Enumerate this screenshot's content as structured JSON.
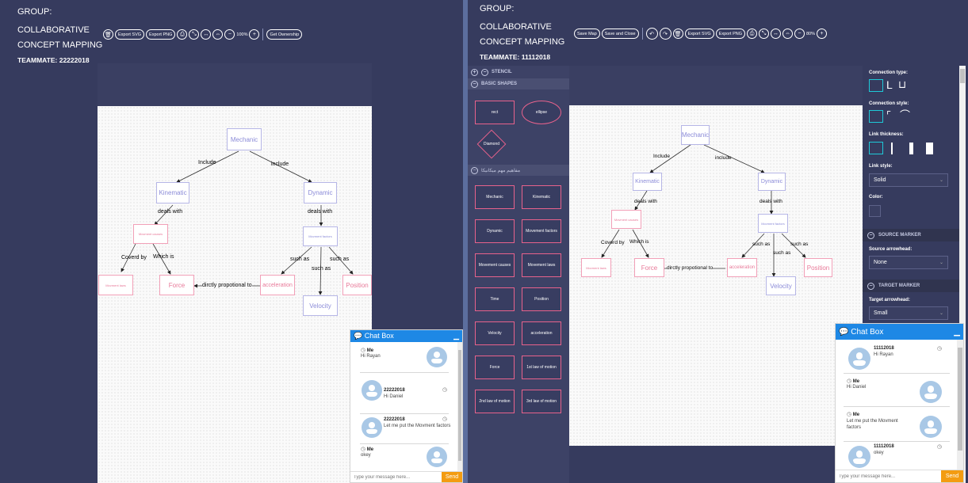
{
  "left": {
    "group": "GROUP:",
    "line1": "COLLABORATIVE",
    "line2": "CONCEPT MAPPING",
    "teammate": "TEAMMATE: 22222018",
    "toolbar": {
      "export_svg": "Export SVG",
      "export_png": "Export PNG",
      "zoom": "100%",
      "get_ownership": "Get Ownership"
    },
    "map": {
      "nodes": {
        "mechanic": "Mechanic",
        "kinematic": "Kinematic",
        "dynamic": "Dynamic",
        "movement_causes": "Movment causes",
        "movement_factors": "Movment factors",
        "movement_laws": "Movment laws",
        "force": "Force",
        "acceleration": "acceleration",
        "position": "Position",
        "velocity": "Velocity"
      },
      "links": {
        "include_left": "Include",
        "include_right": "include",
        "deals_with_left": "deals with",
        "deals_with_right": "deals with",
        "covered_by": "Coverd by",
        "which_is": "Which is",
        "such_as_1": "such as",
        "such_as_2": "such as",
        "such_as_3": "such as",
        "proportional": "dirctly propotional to"
      }
    },
    "chat": {
      "title": "Chat Box",
      "messages": [
        {
          "name": "Me",
          "text": "Hi Rayan"
        },
        {
          "name": "22222018",
          "text": "Hi Daniel"
        },
        {
          "name": "22222018",
          "text": "Let me put the Movment factors"
        },
        {
          "name": "Me",
          "text": "okey"
        }
      ],
      "placeholder": "Type your message here...",
      "send": "Send"
    }
  },
  "right": {
    "group": "GROUP:",
    "line1": "COLLABORATIVE",
    "line2": "CONCEPT MAPPING",
    "teammate": "TEAMMATE: 11112018",
    "toolbar": {
      "save_map": "Save Map",
      "save_close": "Save and Close",
      "export_svg": "Export SVG",
      "export_png": "Export PNG",
      "zoom": "80%"
    },
    "stencil": {
      "title": "STENCIL",
      "basic_shapes": "BASIC SHAPES",
      "rect": "rect",
      "ellipse": "ellipse",
      "diamond": "Diamond",
      "concepts_header": "مفاهيم مهم ميكانيكا",
      "concepts": [
        "Mechanic",
        "Kinematic",
        "Dynamic",
        "Movement factors",
        "Movement causes",
        "Movement laws",
        "Time",
        "Position",
        "Velocity",
        "acceleration",
        "Force",
        "1st law of motion",
        "2nd law of motion",
        "3rd law of motion"
      ]
    },
    "map": {
      "nodes": {
        "mechanic": "Mechanic",
        "kinematic": "Kinematic",
        "dynamic": "Dynamic",
        "movement_causes": "Movment causes",
        "movement_factors": "Movment factors",
        "movement_laws": "Movment laws",
        "force": "Force",
        "acceleration": "acceleration",
        "position": "Position",
        "velocity": "Velocity"
      },
      "links": {
        "include_left": "Include",
        "include_right": "include",
        "deals_with_left": "deals with",
        "deals_with_right": "deals with",
        "covered_by": "Coverd by",
        "which_is": "Which is",
        "such_as_1": "such as",
        "such_as_2": "such as",
        "such_as_3": "such as",
        "proportional": "dirctly propotional to"
      }
    },
    "panel": {
      "connection_type": "Connection type:",
      "connection_style": "Connection style:",
      "link_thickness": "Link thickness:",
      "link_style": "Link style:",
      "link_style_value": "Solid",
      "color": "Color:",
      "source_marker": "SOURCE MARKER",
      "source_arrowhead": "Source arrowhead:",
      "source_value": "None",
      "target_marker": "TARGET MARKER",
      "target_arrowhead": "Target arrowhead:",
      "target_value": "Small"
    },
    "chat": {
      "title": "Chat Box",
      "messages": [
        {
          "name": "11112018",
          "text": "Hi Rayan"
        },
        {
          "name": "Me",
          "text": "Hi Daniel"
        },
        {
          "name": "Me",
          "text": "Let me put the Movment factors"
        },
        {
          "name": "11112018",
          "text": "okey"
        }
      ],
      "placeholder": "Type your message here...",
      "send": "Send"
    }
  },
  "colors": {
    "background": "#363b5e",
    "concept_blue": "#b6b6e6",
    "concept_pink": "#f2a0b8",
    "chat_header": "#1e88e5",
    "send_button": "#f39c12",
    "stencil_border": "#e8628c",
    "selected_tile": "#1ec9d8"
  }
}
